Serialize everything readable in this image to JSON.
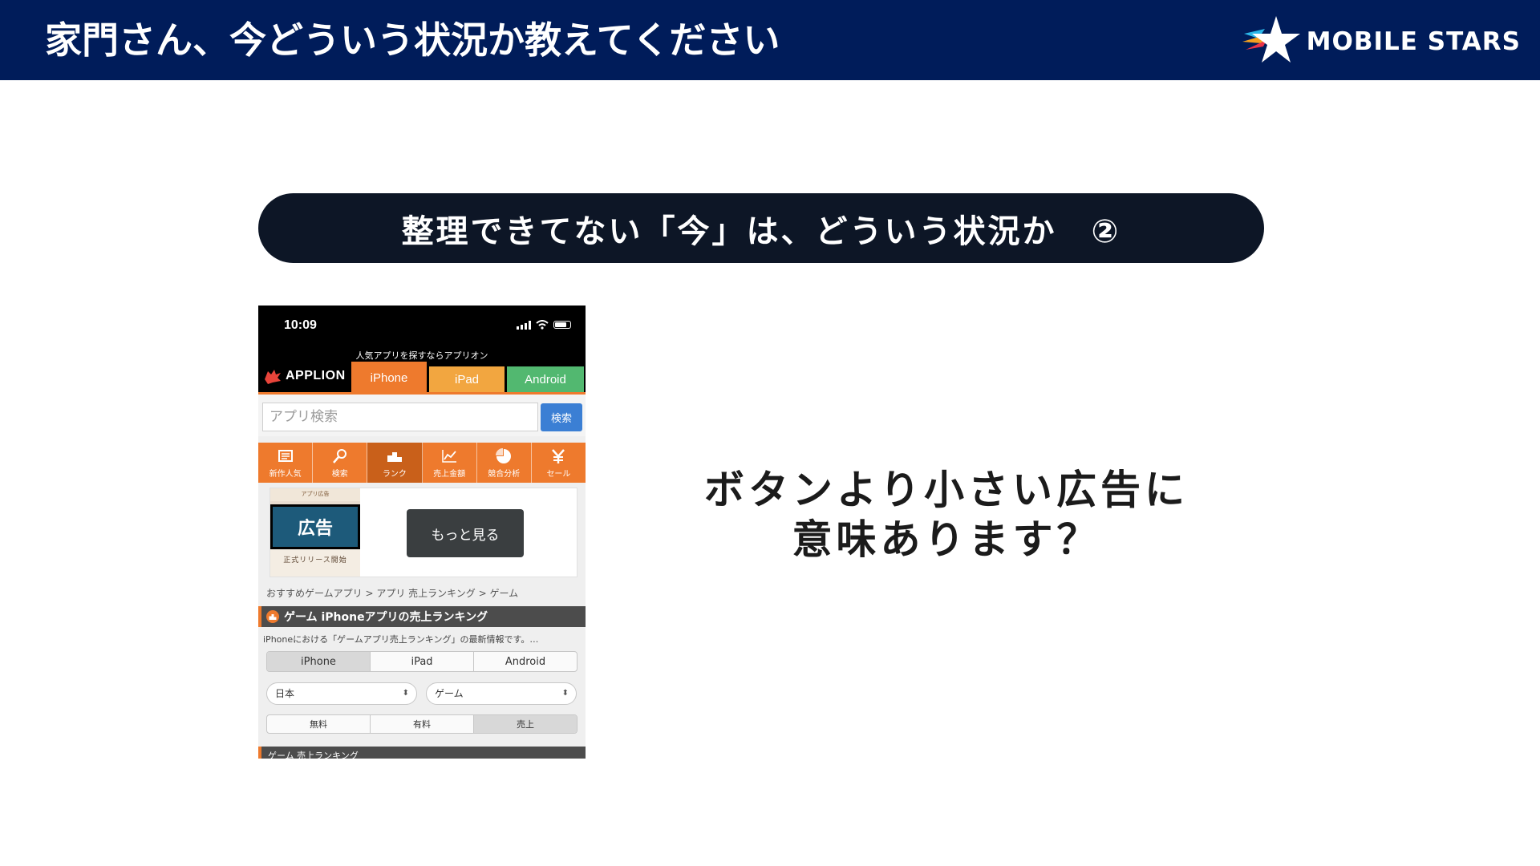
{
  "slide": {
    "title": "家門さん、今どういう状況か教えてください",
    "brand": "MOBILE STARS",
    "banner": "整理できてない「今」は、どういう状況か　②",
    "question_lines": [
      "ボタンより小さい広告に",
      "意味あります？"
    ]
  },
  "phone": {
    "time": "10:09",
    "tagline": "人気アプリを探すならアプリオン",
    "app_name": "APPLION",
    "platform_tabs": [
      "iPhone",
      "iPad",
      "Android"
    ],
    "search_placeholder": "アプリ検索",
    "search_button": "検索",
    "categories": [
      {
        "label": "新作人気",
        "icon": "newspaper-icon"
      },
      {
        "label": "検索",
        "icon": "magnifier-icon"
      },
      {
        "label": "ランク",
        "icon": "podium-icon"
      },
      {
        "label": "売上金額",
        "icon": "line-chart-icon"
      },
      {
        "label": "競合分析",
        "icon": "pie-chart-icon"
      },
      {
        "label": "セール",
        "icon": "yen-icon"
      }
    ],
    "ad_badge": "広告",
    "ad_thumb_top": "アプリ広告",
    "ad_thumb_bottom": "正式リリース開始",
    "more_button": "もっと見る",
    "breadcrumb": "おすすめゲームアプリ > アプリ 売上ランキング > ゲーム",
    "section_title": "ゲーム iPhoneアプリの売上ランキング",
    "description": "iPhoneにおける「ゲームアプリ売上ランキング」の最新情報です。…",
    "segment_platform": [
      "iPhone",
      "iPad",
      "Android"
    ],
    "country_select": "日本",
    "genre_select": "ゲーム",
    "segment_price": [
      "無料",
      "有料",
      "売上"
    ],
    "bottom_section": "ゲーム 売上ランキング"
  },
  "colors": {
    "header_navy": "#001c5a",
    "banner_dark": "#0d1626",
    "applion_orange": "#ee7a2d",
    "ipad_tab": "#f2a640",
    "android_tab": "#52b870",
    "search_blue": "#3b7fd4"
  }
}
